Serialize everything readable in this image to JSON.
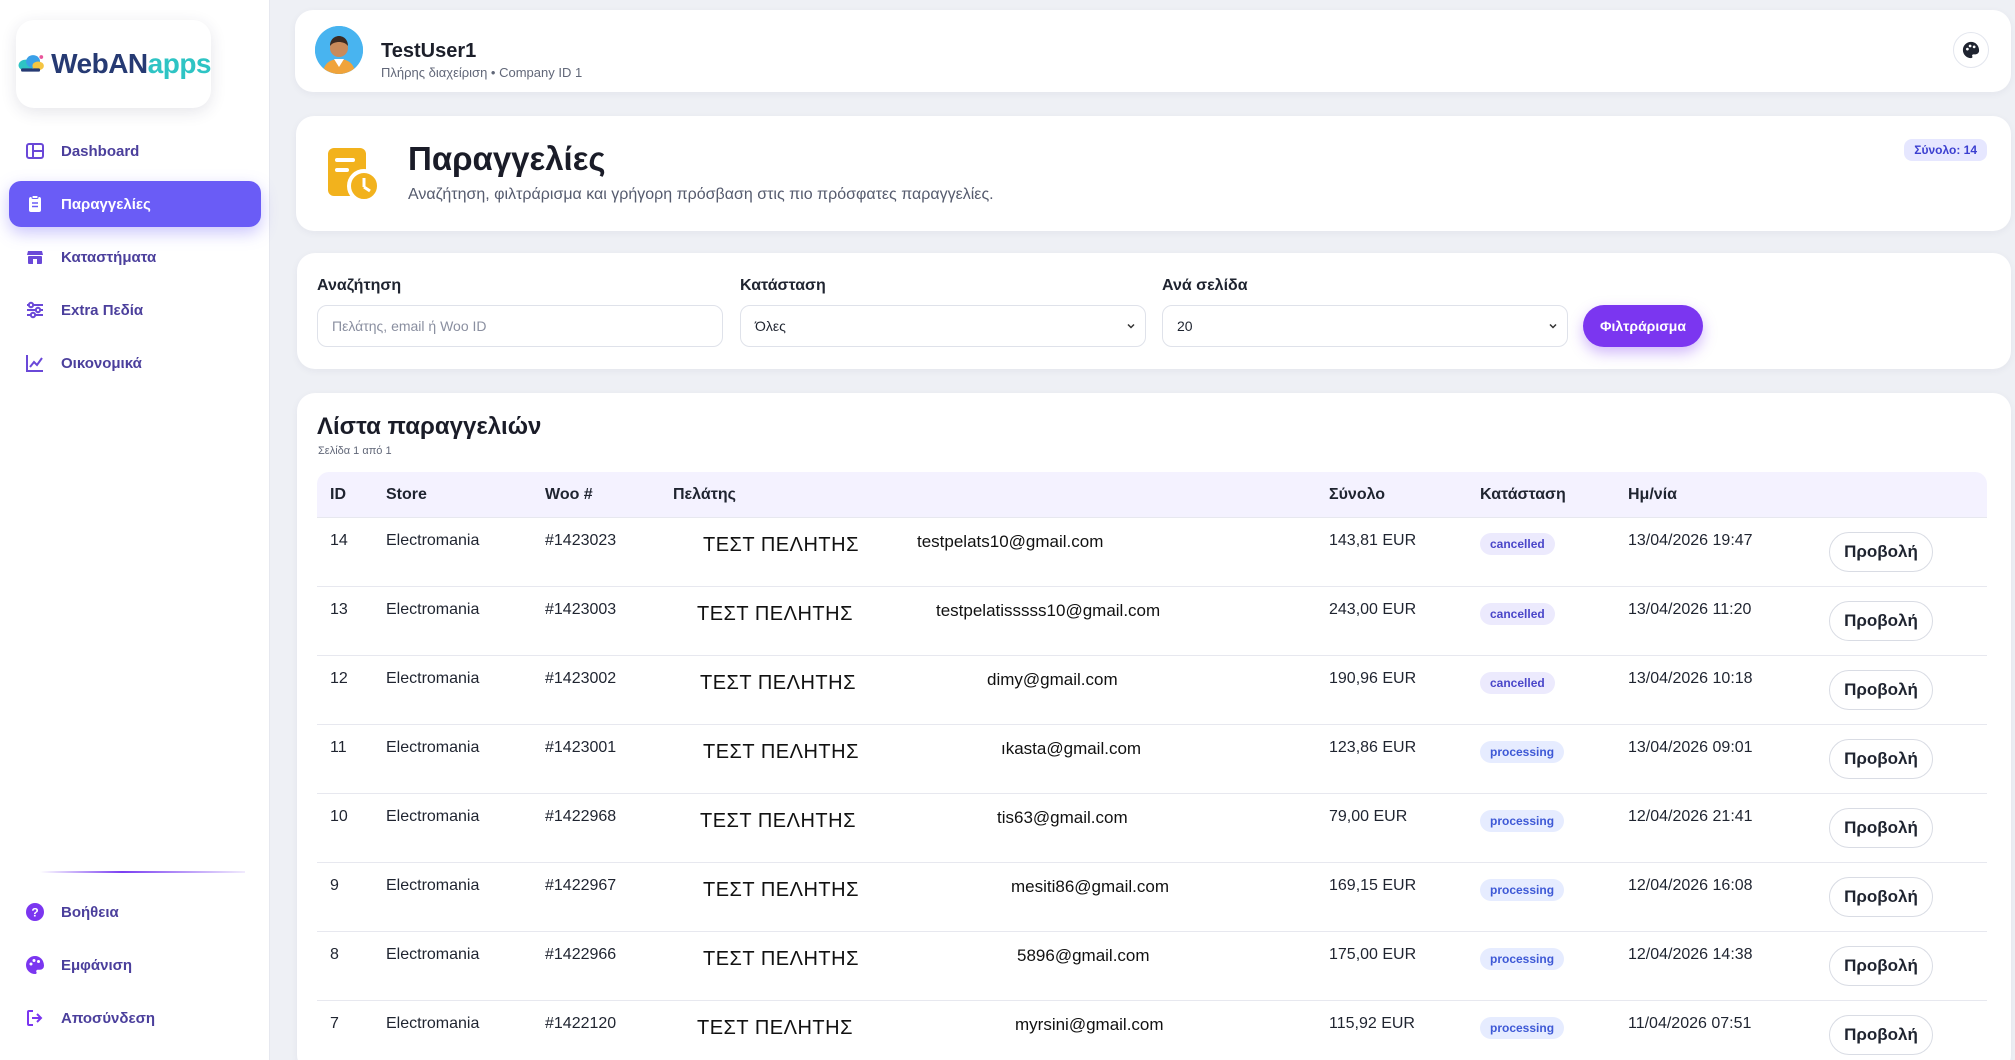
{
  "app": {
    "logo_part1": "WebAN",
    "logo_part2": "apps"
  },
  "sidebar": {
    "items": [
      {
        "label": "Dashboard",
        "icon": "dashboard-icon",
        "active": false
      },
      {
        "label": "Παραγγελίες",
        "icon": "orders-icon",
        "active": true
      },
      {
        "label": "Καταστήματα",
        "icon": "store-icon",
        "active": false
      },
      {
        "label": "Extra Πεδία",
        "icon": "sliders-icon",
        "active": false
      },
      {
        "label": "Οικονομικά",
        "icon": "chart-line-icon",
        "active": false
      }
    ],
    "bottom_items": [
      {
        "label": "Βοήθεια",
        "icon": "help-icon"
      },
      {
        "label": "Εμφάνιση",
        "icon": "palette-icon"
      },
      {
        "label": "Αποσύνδεση",
        "icon": "logout-icon"
      }
    ]
  },
  "user": {
    "name": "TestUser1",
    "subtitle": "Πλήρης διαχείριση • Company ID 1"
  },
  "header": {
    "title": "Παραγγελίες",
    "subtitle": "Αναζήτηση, φιλτράρισμα και γρήγορη πρόσβαση στις πιο πρόσφατες παραγγελίες.",
    "total_badge": "Σύνολο: 14"
  },
  "filters": {
    "search_label": "Αναζήτηση",
    "search_placeholder": "Πελάτης, email ή Woo ID",
    "status_label": "Κατάσταση",
    "status_value": "Όλες",
    "per_page_label": "Ανά σελίδα",
    "per_page_value": "20",
    "filter_button": "Φιλτράρισμα"
  },
  "list": {
    "title": "Λίστα παραγγελιών",
    "subtitle": "Σελίδα 1 από 1",
    "columns": [
      "ID",
      "Store",
      "Woo #",
      "Πελάτης",
      "Σύνολο",
      "Κατάσταση",
      "Ημ/νία"
    ],
    "view_label": "Προβολή",
    "rows": [
      {
        "id": "14",
        "store": "Electromania",
        "woo": "#1423023",
        "customer": "ΤΕΣΤ ΠΕΛΗΤΗΣ",
        "email": "testpelats10@gmail.com",
        "total": "143,81 EUR",
        "status": "cancelled",
        "date": "13/04/2026 19:47"
      },
      {
        "id": "13",
        "store": "Electromania",
        "woo": "#1423003",
        "customer": "ΤΕΣΤ ΠΕΛΗΤΗΣ",
        "email": "testpelatisssss10@gmail.com",
        "total": "243,00 EUR",
        "status": "cancelled",
        "date": "13/04/2026 11:20"
      },
      {
        "id": "12",
        "store": "Electromania",
        "woo": "#1423002",
        "customer": "ΤΕΣΤ ΠΕΛΗΤΗΣ",
        "email": "dimy@gmail.com",
        "total": "190,96 EUR",
        "status": "cancelled",
        "date": "13/04/2026 10:18"
      },
      {
        "id": "11",
        "store": "Electromania",
        "woo": "#1423001",
        "customer": "ΤΕΣΤ ΠΕΛΗΤΗΣ",
        "email": "ıkasta@gmail.com",
        "total": "123,86 EUR",
        "status": "processing",
        "date": "13/04/2026 09:01"
      },
      {
        "id": "10",
        "store": "Electromania",
        "woo": "#1422968",
        "customer": "ΤΕΣΤ ΠΕΛΗΤΗΣ",
        "email": "tis63@gmail.com",
        "total": "79,00 EUR",
        "status": "processing",
        "date": "12/04/2026 21:41"
      },
      {
        "id": "9",
        "store": "Electromania",
        "woo": "#1422967",
        "customer": "ΤΕΣΤ ΠΕΛΗΤΗΣ",
        "email": "mesiti86@gmail.com",
        "total": "169,15 EUR",
        "status": "processing",
        "date": "12/04/2026 16:08"
      },
      {
        "id": "8",
        "store": "Electromania",
        "woo": "#1422966",
        "customer": "ΤΕΣΤ ΠΕΛΗΤΗΣ",
        "email": "5896@gmail.com",
        "total": "175,00 EUR",
        "status": "processing",
        "date": "12/04/2026 14:38"
      },
      {
        "id": "7",
        "store": "Electromania",
        "woo": "#1422120",
        "customer": "ΤΕΣΤ ΠΕΛΗΤΗΣ",
        "email": "myrsini@gmail.com",
        "total": "115,92 EUR",
        "status": "processing",
        "date": "11/04/2026 07:51"
      }
    ]
  },
  "colors": {
    "accent": "#6a5cf6",
    "primary_button": "#7b36f0",
    "badge_bg": "#e6e7ff"
  }
}
